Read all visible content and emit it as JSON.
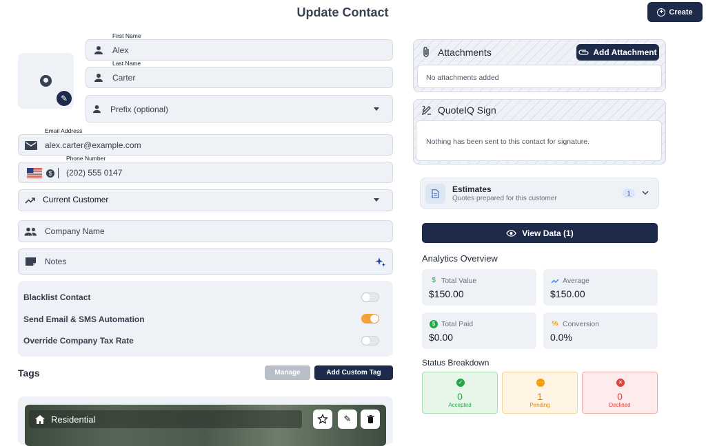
{
  "header": {
    "title": "Update Contact",
    "create_label": "Create"
  },
  "form": {
    "first_name": {
      "label": "First Name",
      "value": "Alex"
    },
    "last_name": {
      "label": "Last Name",
      "value": "Carter"
    },
    "prefix": {
      "placeholder": "Prefix (optional)"
    },
    "email": {
      "label": "Email Address",
      "value": "alex.carter@example.com"
    },
    "phone": {
      "label": "Phone Number",
      "value": "(202) 555 0147"
    },
    "status": {
      "value": "Current Customer"
    },
    "company": {
      "placeholder": "Company Name"
    },
    "notes": {
      "placeholder": "Notes"
    }
  },
  "toggles": [
    {
      "label": "Blacklist Contact",
      "on": false
    },
    {
      "label": "Send Email & SMS Automation",
      "on": true
    },
    {
      "label": "Override Company Tax Rate",
      "on": false
    }
  ],
  "tags": {
    "heading": "Tags",
    "manage_label": "Manage",
    "add_label": "Add Custom Tag",
    "items": [
      {
        "label": "Residential"
      }
    ]
  },
  "attachments": {
    "title": "Attachments",
    "add_label": "Add Attachment",
    "empty_text": "No attachments added"
  },
  "sign": {
    "title": "QuoteIQ Sign",
    "empty_text": "Nothing has been sent to this contact for signature."
  },
  "estimates": {
    "title": "Estimates",
    "subtitle": "Quotes prepared for this customer",
    "count": "1"
  },
  "view_data_label": "View Data (1)",
  "analytics": {
    "title": "Analytics Overview",
    "total_value": {
      "label": "Total Value",
      "value": "$150.00"
    },
    "average": {
      "label": "Average",
      "value": "$150.00"
    },
    "total_paid": {
      "label": "Total Paid",
      "value": "$0.00"
    },
    "conversion": {
      "label": "Conversion",
      "value": "0.0%"
    }
  },
  "status_breakdown": {
    "title": "Status Breakdown",
    "accepted": {
      "count": "0",
      "label": "Accepted"
    },
    "pending": {
      "count": "1",
      "label": "Pending"
    },
    "declined": {
      "count": "0",
      "label": "Declined"
    }
  },
  "colors": {
    "primary": "#1e2a4a",
    "toggle_on": "#f5a13a",
    "accepted": "#22a84a",
    "pending": "#f59e0b",
    "declined": "#e0413a"
  }
}
